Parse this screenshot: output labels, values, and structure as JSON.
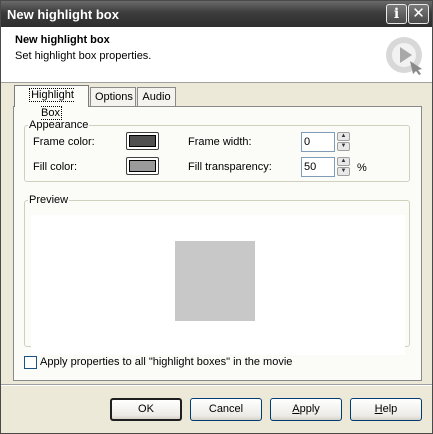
{
  "window": {
    "title": "New highlight box"
  },
  "titlebar_buttons": {
    "info": "i",
    "close": "✕"
  },
  "header": {
    "title": "New highlight box",
    "subtitle": "Set highlight box properties."
  },
  "tabs": [
    {
      "label": "Highlight Box",
      "active": true
    },
    {
      "label": "Options",
      "active": false
    },
    {
      "label": "Audio",
      "active": false
    }
  ],
  "appearance": {
    "legend": "Appearance",
    "frame_color_label": "Frame color:",
    "frame_color": "#505050",
    "fill_color_label": "Fill color:",
    "fill_color": "#9a9a9a",
    "frame_width_label": "Frame width:",
    "frame_width_value": "0",
    "fill_transparency_label": "Fill transparency:",
    "fill_transparency_value": "50",
    "percent_unit": "%"
  },
  "preview": {
    "legend": "Preview",
    "box_color": "#c8c8c8"
  },
  "apply_all": {
    "label": "Apply properties to all \"highlight boxes\" in the movie",
    "checked": false
  },
  "buttons": {
    "ok": "OK",
    "cancel": "Cancel",
    "apply_first": "A",
    "apply_rest": "pply",
    "help_first": "H",
    "help_rest": "elp"
  }
}
